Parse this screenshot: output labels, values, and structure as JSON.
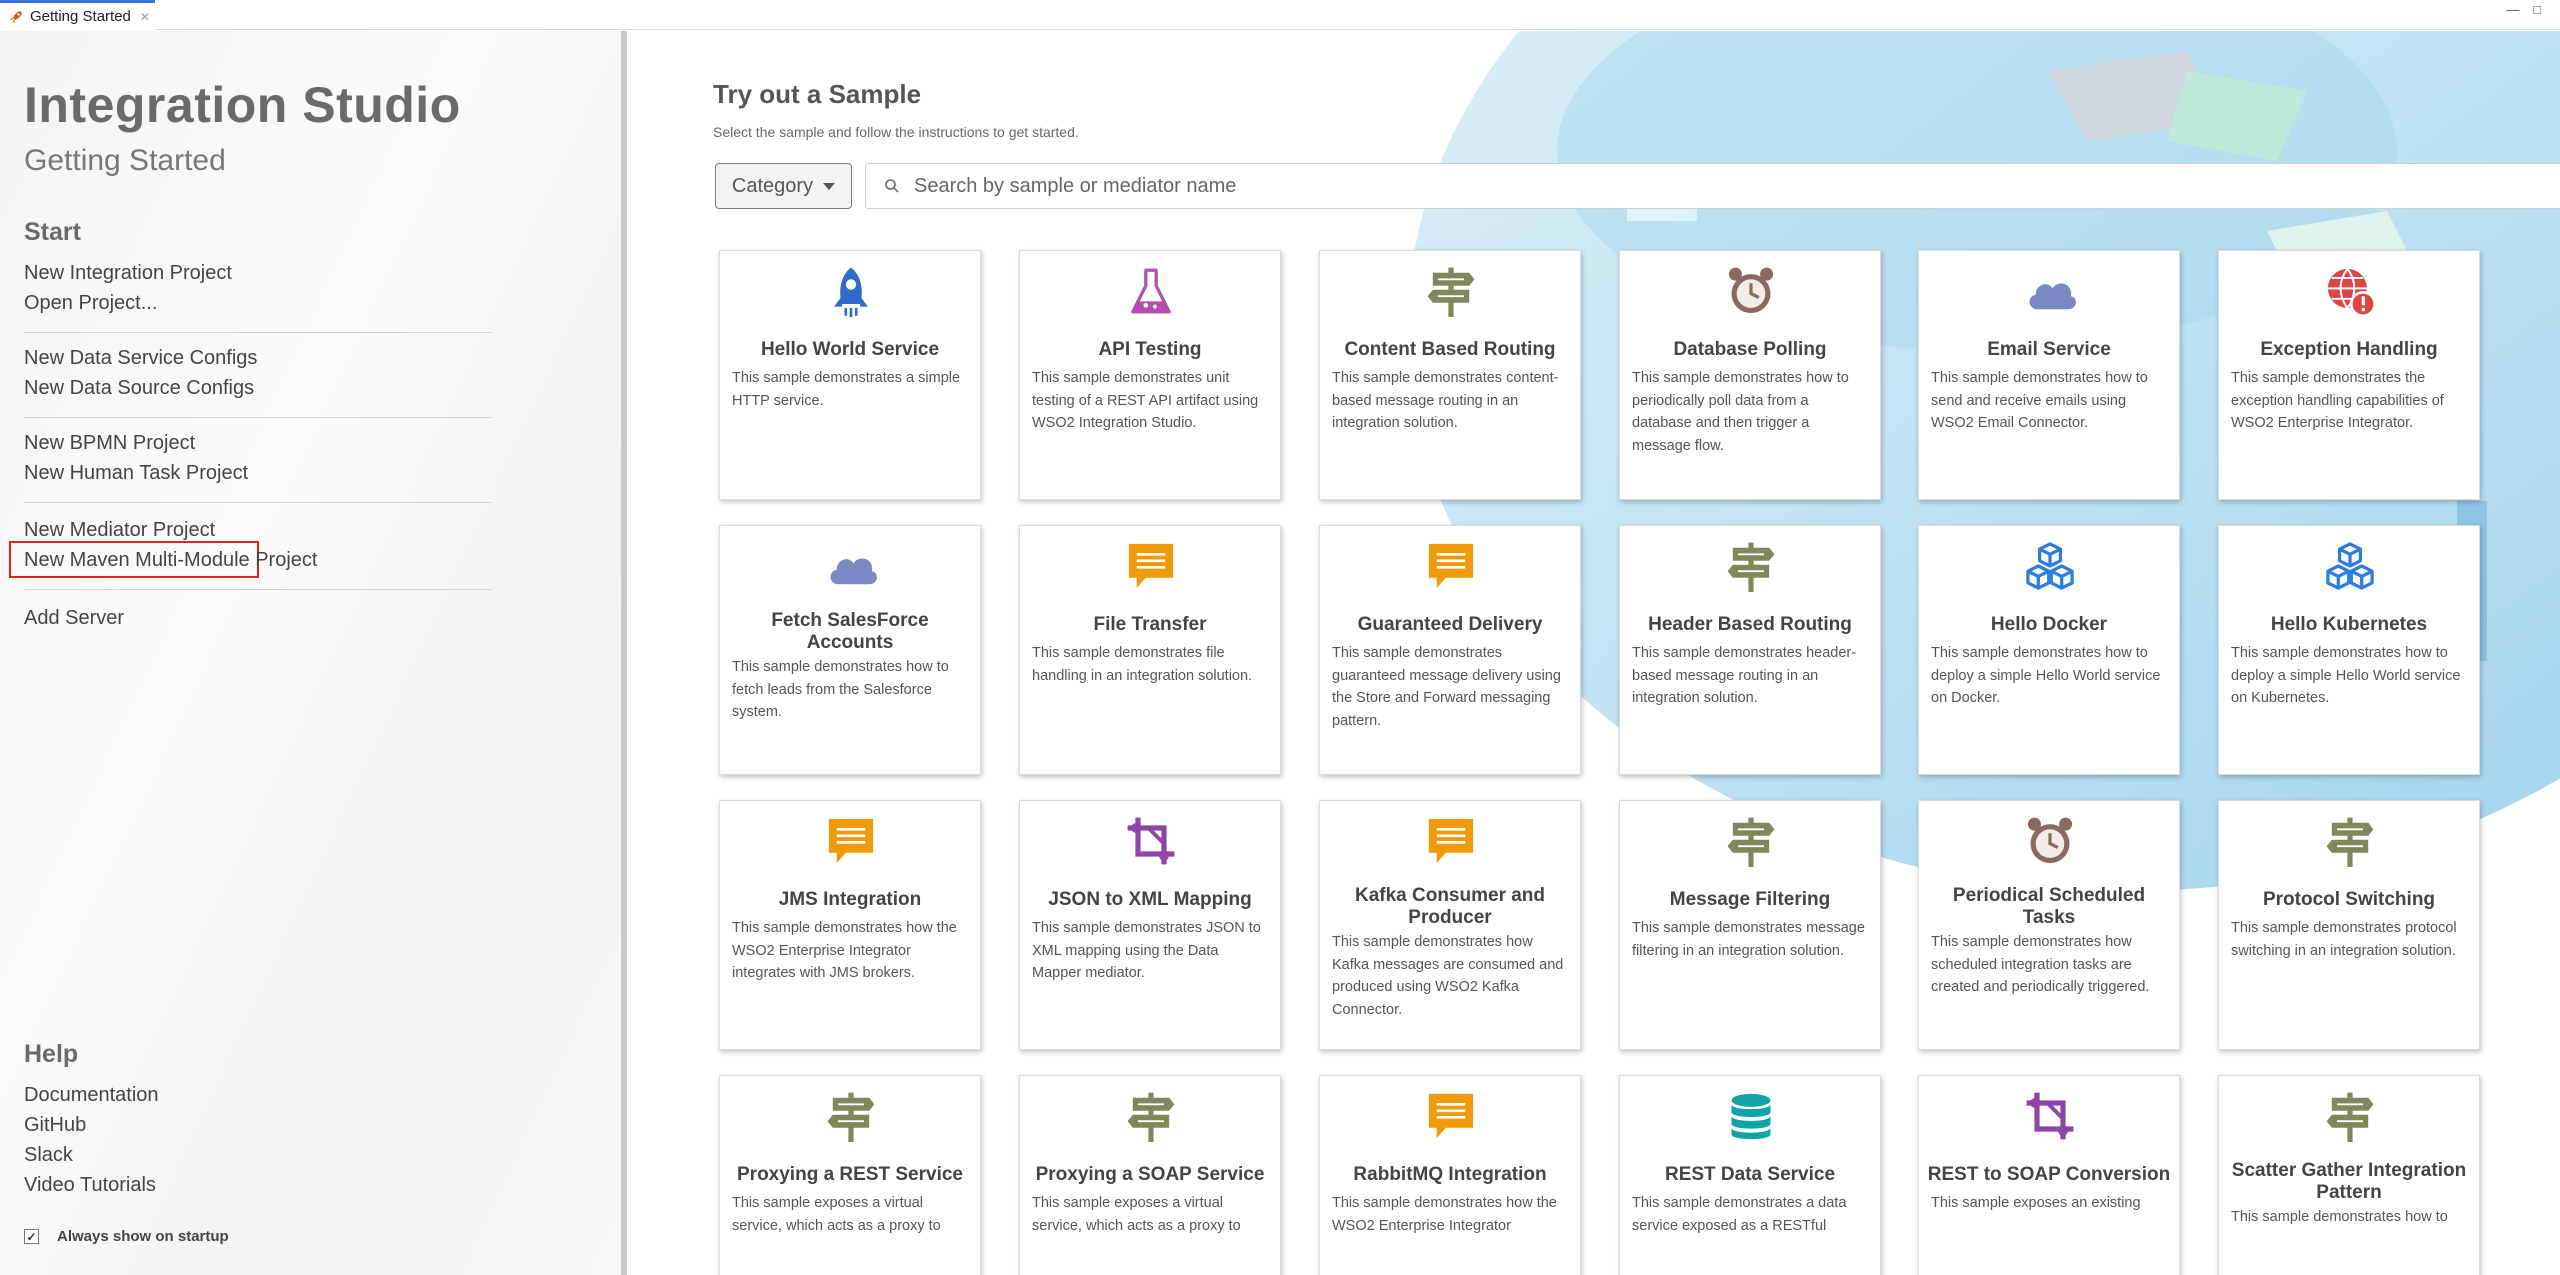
{
  "tab": {
    "title": "Getting Started",
    "close": "✕"
  },
  "window": {
    "minimize": "—",
    "maximize": "□"
  },
  "left": {
    "app_title": "Integration Studio",
    "subtitle": "Getting Started",
    "start_heading": "Start",
    "start_groups": [
      [
        "New Integration Project",
        "Open Project..."
      ],
      [
        "New Data Service Configs",
        "New Data Source Configs"
      ],
      [
        "New BPMN Project",
        "New Human Task Project"
      ],
      [
        "New Mediator Project",
        "New Maven Multi-Module Project"
      ],
      [
        "Add Server"
      ]
    ],
    "help_heading": "Help",
    "help_links": [
      "Documentation",
      "GitHub",
      "Slack",
      "Video Tutorials"
    ],
    "always_show": "Always show on startup",
    "always_show_checked": true
  },
  "main": {
    "title": "Try out a Sample",
    "subtitle": "Select the sample and follow the instructions to get started.",
    "category_label": "Category",
    "search_placeholder": "Search by sample or mediator name",
    "samples": [
      {
        "title": "Hello World Service",
        "desc": "This sample demonstrates a simple HTTP service.",
        "icon": "rocket-icon",
        "color": "#2f6cc9"
      },
      {
        "title": "API Testing",
        "desc": "This sample demonstrates unit testing of a REST API artifact using WSO2 Integration Studio.",
        "icon": "flask-icon",
        "color": "#b04fae"
      },
      {
        "title": "Content Based Routing",
        "desc": "This sample demonstrates content-based message routing in an integration solution.",
        "icon": "signpost-icon",
        "color": "#80875a"
      },
      {
        "title": "Database Polling",
        "desc": "This sample demonstrates how to periodically poll data from a database and then trigger a message flow.",
        "icon": "alarm-clock-icon",
        "color": "#8a6a5e"
      },
      {
        "title": "Email Service",
        "desc": "This sample demonstrates how to send and receive emails using WSO2 Email Connector.",
        "icon": "cloud-icon",
        "color": "#7a88c4"
      },
      {
        "title": "Exception Handling",
        "desc": "This sample demonstrates the exception handling capabilities of WSO2 Enterprise Integrator.",
        "icon": "globe-alert-icon",
        "color": "#e04343"
      },
      {
        "title": "Fetch SalesForce Accounts",
        "desc": "This sample demonstrates how to fetch leads from the Salesforce system.",
        "icon": "cloud-icon",
        "color": "#7a88c4"
      },
      {
        "title": "File Transfer",
        "desc": "This sample demonstrates file handling in an integration solution.",
        "icon": "message-icon",
        "color": "#f29b0a"
      },
      {
        "title": "Guaranteed Delivery",
        "desc": "This sample demonstrates guaranteed message delivery using the Store and Forward messaging pattern.",
        "icon": "message-icon",
        "color": "#f29b0a"
      },
      {
        "title": "Header Based Routing",
        "desc": "This sample demonstrates header-based message routing in an integration solution.",
        "icon": "signpost-icon",
        "color": "#80875a"
      },
      {
        "title": "Hello Docker",
        "desc": "This sample demonstrates how to deploy a simple Hello World service on Docker.",
        "icon": "cubes-icon",
        "color": "#2d7de0"
      },
      {
        "title": "Hello Kubernetes",
        "desc": "This sample demonstrates how to deploy a simple Hello World service on Kubernetes.",
        "icon": "cubes-icon",
        "color": "#2d7de0"
      },
      {
        "title": "JMS Integration",
        "desc": "This sample demonstrates how the WSO2 Enterprise Integrator integrates with JMS brokers.",
        "icon": "message-icon",
        "color": "#f29b0a"
      },
      {
        "title": "JSON to XML Mapping",
        "desc": "This sample demonstrates JSON to XML mapping using the Data Mapper mediator.",
        "icon": "crop-icon",
        "color": "#8e45a8"
      },
      {
        "title": "Kafka Consumer and Producer",
        "desc": "This sample demonstrates how Kafka messages are consumed and produced using WSO2 Kafka Connector.",
        "icon": "message-icon",
        "color": "#f29b0a"
      },
      {
        "title": "Message Filtering",
        "desc": "This sample demonstrates message filtering in an integration solution.",
        "icon": "signpost-icon",
        "color": "#80875a"
      },
      {
        "title": "Periodical Scheduled Tasks",
        "desc": "This sample demonstrates how scheduled integration tasks are created and periodically triggered.",
        "icon": "alarm-clock-icon",
        "color": "#8a6a5e"
      },
      {
        "title": "Protocol Switching",
        "desc": "This sample demonstrates protocol switching in an integration solution.",
        "icon": "signpost-icon",
        "color": "#80875a"
      },
      {
        "title": "Proxying a REST Service",
        "desc": "This sample exposes a virtual service, which acts as a proxy to",
        "icon": "signpost-icon",
        "color": "#80875a"
      },
      {
        "title": "Proxying a SOAP Service",
        "desc": "This sample exposes a virtual service, which acts as a proxy to",
        "icon": "signpost-icon",
        "color": "#80875a"
      },
      {
        "title": "RabbitMQ Integration",
        "desc": "This sample demonstrates how the WSO2 Enterprise Integrator",
        "icon": "message-icon",
        "color": "#f29b0a"
      },
      {
        "title": "REST Data Service",
        "desc": "This sample demonstrates a data service exposed as a RESTful",
        "icon": "database-icon",
        "color": "#12a3a8"
      },
      {
        "title": "REST to SOAP Conversion",
        "desc": "This sample exposes an existing",
        "icon": "crop-icon",
        "color": "#8e45a8"
      },
      {
        "title": "Scatter Gather Integration Pattern",
        "desc": "This sample demonstrates how to",
        "icon": "signpost-icon",
        "color": "#80875a"
      }
    ]
  }
}
